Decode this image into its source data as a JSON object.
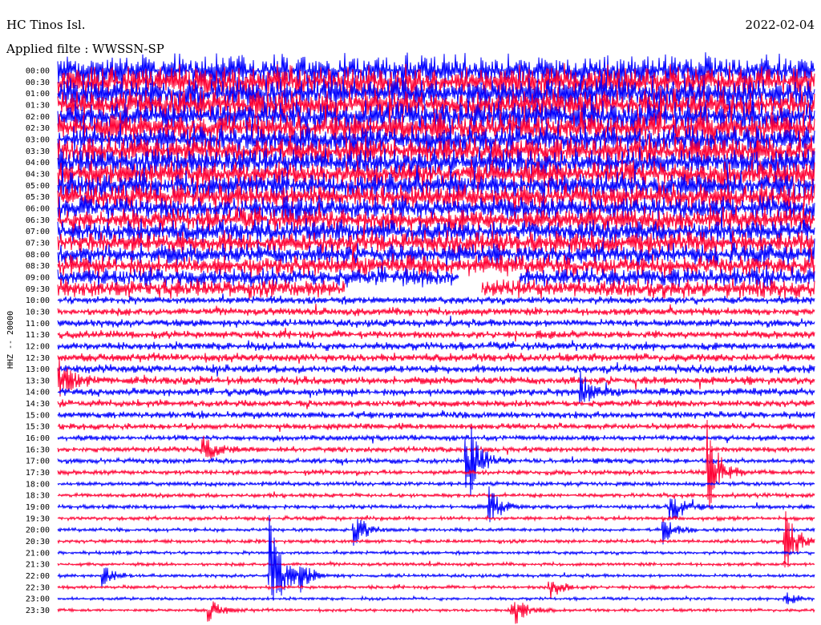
{
  "header": {
    "station": "HC Tinos Isl.",
    "date": "2022-02-04",
    "filter": "Applied filte : WWSSN-SP"
  },
  "chart_data": {
    "type": "line",
    "title": "HC Tinos Isl.",
    "date": "2022-02-04",
    "filter_label": "Applied filte : WWSSN-SP",
    "ylabel": "HHZ -- 20000",
    "row_labels": [
      "00:00",
      "00:30",
      "01:00",
      "01:30",
      "02:00",
      "02:30",
      "03:00",
      "03:30",
      "04:00",
      "04:30",
      "05:00",
      "05:30",
      "06:00",
      "06:30",
      "07:00",
      "07:30",
      "08:00",
      "08:30",
      "09:00",
      "09:30",
      "10:00",
      "10:30",
      "11:00",
      "11:30",
      "12:00",
      "12:30",
      "13:00",
      "13:30",
      "14:00",
      "14:30",
      "15:00",
      "15:30",
      "16:00",
      "16:30",
      "17:00",
      "17:30",
      "18:00",
      "18:30",
      "19:00",
      "19:30",
      "20:00",
      "20:30",
      "21:00",
      "21:30",
      "22:00",
      "22:30",
      "23:00",
      "23:30"
    ],
    "series_colors": [
      "#0000ff",
      "#ff0033"
    ],
    "noise_amplitude": [
      1.0,
      1.0,
      1.0,
      0.95,
      0.95,
      0.95,
      0.9,
      0.9,
      0.85,
      0.85,
      0.8,
      0.8,
      0.75,
      0.75,
      0.7,
      0.7,
      0.65,
      0.65,
      0.6,
      0.55,
      0.2,
      0.2,
      0.2,
      0.2,
      0.22,
      0.22,
      0.22,
      0.22,
      0.2,
      0.18,
      0.17,
      0.15,
      0.12,
      0.12,
      0.11,
      0.1,
      0.08,
      0.08,
      0.08,
      0.07,
      0.06,
      0.06,
      0.05,
      0.05,
      0.05,
      0.05,
      0.04,
      0.04
    ],
    "gaps": [
      {
        "row": "09:00",
        "from": 0.53,
        "to": 0.61
      },
      {
        "row": "09:30",
        "from": 0.38,
        "to": 0.56
      }
    ],
    "events": [
      {
        "row": "13:30",
        "pos": 0.0,
        "amp": 1.2
      },
      {
        "row": "14:00",
        "pos": 0.69,
        "amp": 1.0
      },
      {
        "row": "16:30",
        "pos": 0.19,
        "amp": 0.9
      },
      {
        "row": "17:00",
        "pos": 0.54,
        "amp": 2.4
      },
      {
        "row": "17:30",
        "pos": 0.86,
        "amp": 2.2
      },
      {
        "row": "19:00",
        "pos": 0.57,
        "amp": 0.9
      },
      {
        "row": "19:00",
        "pos": 0.81,
        "amp": 1.1
      },
      {
        "row": "20:00",
        "pos": 0.39,
        "amp": 0.9
      },
      {
        "row": "20:00",
        "pos": 0.8,
        "amp": 0.6
      },
      {
        "row": "20:30",
        "pos": 0.96,
        "amp": 1.6
      },
      {
        "row": "22:00",
        "pos": 0.28,
        "amp": 3.0
      },
      {
        "row": "22:00",
        "pos": 0.32,
        "amp": 0.6
      },
      {
        "row": "22:00",
        "pos": 0.06,
        "amp": 0.5
      },
      {
        "row": "22:30",
        "pos": 0.65,
        "amp": 0.6
      },
      {
        "row": "23:00",
        "pos": 0.96,
        "amp": 0.4
      },
      {
        "row": "23:30",
        "pos": 0.6,
        "amp": 0.9
      },
      {
        "row": "23:30",
        "pos": 0.2,
        "amp": 0.5
      }
    ]
  }
}
